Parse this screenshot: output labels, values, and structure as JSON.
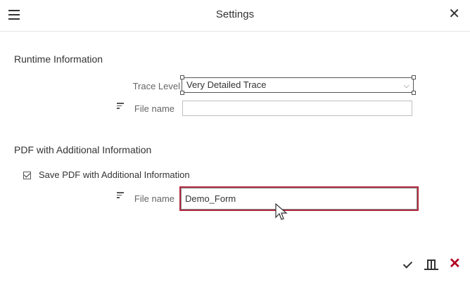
{
  "dialog": {
    "title": "Settings"
  },
  "runtime_section": {
    "title": "Runtime Information",
    "trace_level": {
      "label": "Trace Level",
      "value": "Very Detailed Trace"
    },
    "file_name": {
      "label": "File name",
      "value": ""
    }
  },
  "pdf_section": {
    "title": "PDF with Additional Information",
    "save_checkbox": {
      "label": "Save PDF with Additional Information",
      "checked": true
    },
    "file_name": {
      "label": "File name",
      "value": "Demo_Form"
    }
  },
  "footer": {
    "ok": "check-icon",
    "columns": "columns-icon",
    "cancel": "cancel-icon"
  },
  "colors": {
    "focus_border": "#b02a40",
    "cancel": "#b00020"
  }
}
